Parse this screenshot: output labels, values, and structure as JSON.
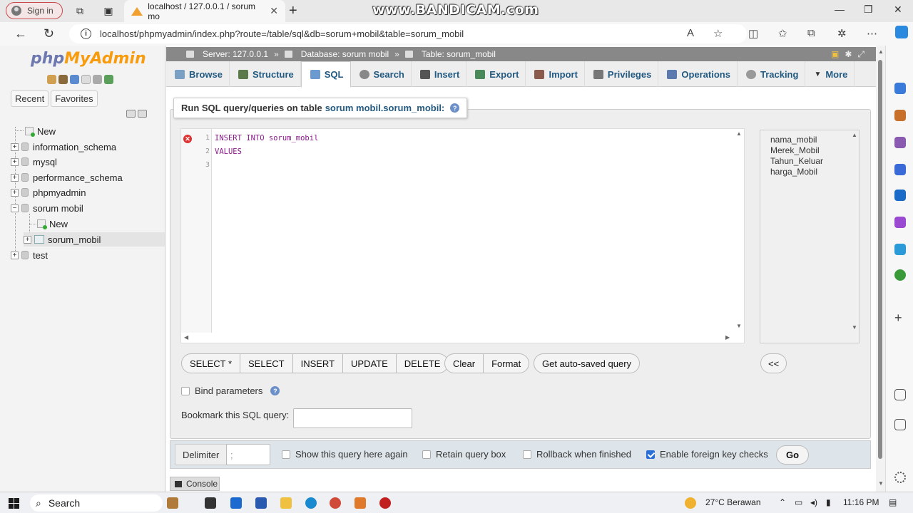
{
  "browser": {
    "signin_label": "Sign in",
    "tab_title": "localhost / 127.0.0.1 / sorum mo",
    "watermark": "www.BANDICAM.com",
    "url": "localhost/phpmyadmin/index.php?route=/table/sql&db=sorum+mobil&table=sorum_mobil"
  },
  "sidebar": {
    "logo_php": "php",
    "logo_myadmin": "MyAdmin",
    "tabs": [
      "Recent",
      "Favorites"
    ],
    "tree": [
      {
        "label": "New"
      },
      {
        "label": "information_schema"
      },
      {
        "label": "mysql"
      },
      {
        "label": "performance_schema"
      },
      {
        "label": "phpmyadmin"
      },
      {
        "label": "sorum mobil"
      },
      {
        "label": "New"
      },
      {
        "label": "sorum_mobil"
      },
      {
        "label": "test"
      }
    ]
  },
  "breadcrumb": {
    "server": "Server: 127.0.0.1",
    "database": "Database: sorum mobil",
    "table": "Table: sorum_mobil"
  },
  "menu": {
    "tabs": [
      "Browse",
      "Structure",
      "SQL",
      "Search",
      "Insert",
      "Export",
      "Import",
      "Privileges",
      "Operations",
      "Tracking",
      "More"
    ],
    "active": "SQL",
    "icon_colors": [
      "#7aa0c4",
      "#5a7a4a",
      "#6a9ad0",
      "#888",
      "#555",
      "#4a8a5a",
      "#8a5a4a",
      "#777",
      "#5a7ab0",
      "#999",
      "#333"
    ]
  },
  "sql": {
    "legend_prefix": "Run SQL query/queries on table",
    "legend_table": "sorum mobil.sorum_mobil:",
    "lines": [
      {
        "num": "1",
        "text": "INSERT INTO sorum_mobil",
        "error": true
      },
      {
        "num": "2",
        "text": "VALUES",
        "error": false
      },
      {
        "num": "3",
        "text": "",
        "error": false
      }
    ],
    "columns": [
      "nama_mobil",
      "Merek_Mobil",
      "Tahun_Keluar",
      "harga_Mobil"
    ],
    "buttons": [
      "SELECT *",
      "SELECT",
      "INSERT",
      "UPDATE",
      "DELETE"
    ],
    "buttons2": [
      "Clear",
      "Format"
    ],
    "autosave_label": "Get auto-saved query",
    "insert_cols_label": "<<",
    "bind_params_label": "Bind parameters",
    "bookmark_label": "Bookmark this SQL query:",
    "bookmark_value": ""
  },
  "options": {
    "delimiter_label": "Delimiter",
    "delimiter_value": ";",
    "show_query_label": "Show this query here again",
    "retain_label": "Retain query box",
    "rollback_label": "Rollback when finished",
    "fk_label": "Enable foreign key checks",
    "go_label": "Go"
  },
  "console_label": "Console",
  "taskbar": {
    "search_label": "Search",
    "weather": "27°C  Berawan",
    "time": "11:16 PM"
  }
}
